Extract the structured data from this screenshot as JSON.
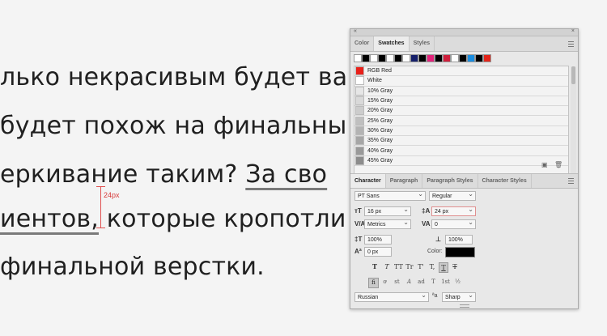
{
  "document": {
    "lines": [
      "лько некрасивым будет ва",
      "будет похож на финальны",
      "еркивание таким?",
      "иентов,",
      "которые кропотли",
      " финальной верстки."
    ],
    "line3_underlined": "За сво",
    "measurement_label": "24px"
  },
  "panel": {
    "title_controls": {
      "collapse": "«",
      "close": "×"
    },
    "tabs": [
      "Color",
      "Swatches",
      "Styles"
    ],
    "active_tab": "Swatches",
    "top_swatches": [
      "#ffffff",
      "#000000",
      "#ffffff",
      "#000000",
      "#ffffff",
      "#000000",
      "#ffffff",
      "#16206a",
      "#000000",
      "#e3237b",
      "#000000",
      "#cf1f3c",
      "#ffffff",
      "#000000",
      "#1a8de0",
      "#000000",
      "#e3261b"
    ],
    "swatch_list": [
      {
        "name": "RGB Red",
        "color": "#e8201a"
      },
      {
        "name": "White",
        "color": "#ffffff"
      },
      {
        "name": "10% Gray",
        "color": "#e6e6e6"
      },
      {
        "name": "15% Gray",
        "color": "#d9d9d9"
      },
      {
        "name": "20% Gray",
        "color": "#cccccc"
      },
      {
        "name": "25% Gray",
        "color": "#bfbfbf"
      },
      {
        "name": "30% Gray",
        "color": "#b3b3b3"
      },
      {
        "name": "35% Gray",
        "color": "#a6a6a6"
      },
      {
        "name": "40% Gray",
        "color": "#999999"
      },
      {
        "name": "45% Gray",
        "color": "#8c8c8c"
      }
    ],
    "swatch_footer_icons": [
      "new-swatch-icon",
      "trash-icon"
    ],
    "char_tabs": [
      "Character",
      "Paragraph",
      "Paragraph Styles",
      "Character Styles"
    ],
    "active_char_tab": "Character",
    "character": {
      "font_family": "PT Sans",
      "font_style": "Regular",
      "font_size": "16 px",
      "leading": "24 px",
      "kerning": "Metrics",
      "tracking": "0",
      "vertical_scale": "100%",
      "horizontal_scale": "100%",
      "baseline_shift": "0 px",
      "color_label": "Color:",
      "color_value": "#000000",
      "language": "Russian",
      "antialias": "Sharp",
      "aa_label": "ªa",
      "style_buttons": [
        "T",
        "T",
        "TT",
        "Tr",
        "T'",
        "T,",
        "T",
        "T"
      ],
      "opentype_buttons": [
        "fi",
        "ơ",
        "st",
        "A",
        "ad",
        "T",
        "1st",
        "½"
      ]
    }
  }
}
